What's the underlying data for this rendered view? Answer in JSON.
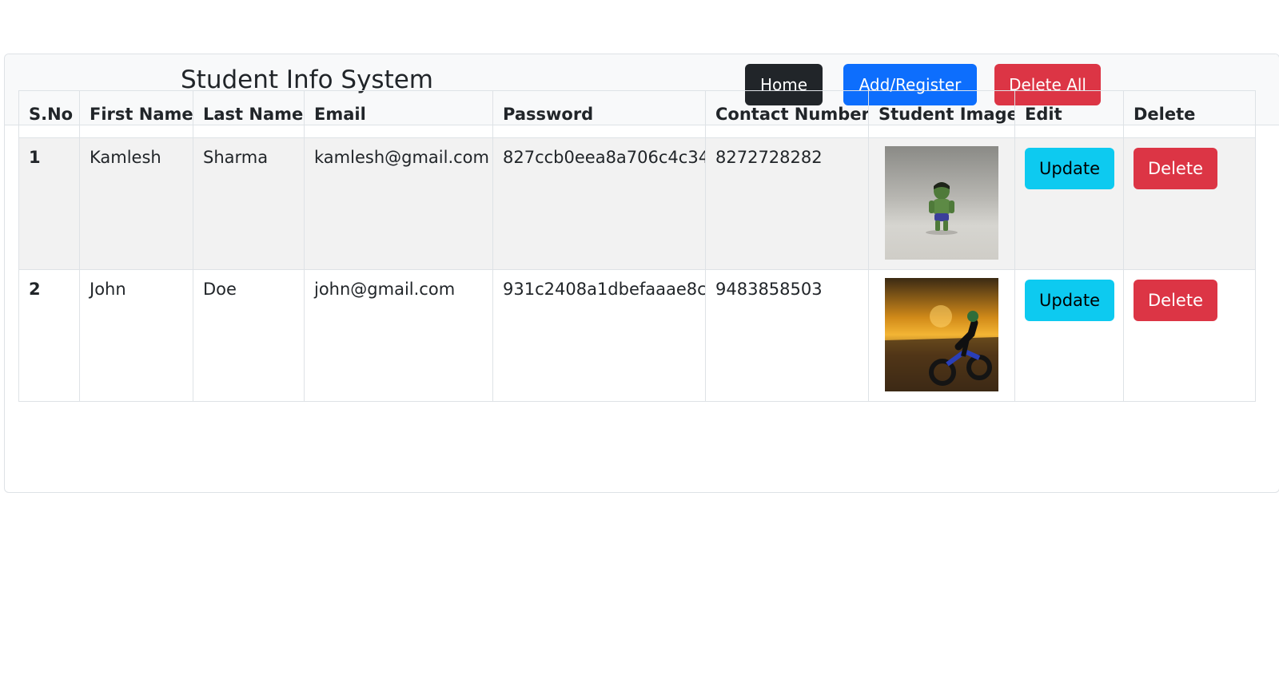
{
  "header": {
    "title": "Student Info System",
    "buttons": {
      "home": "Home",
      "add_register": "Add/Register",
      "delete_all": "Delete All"
    }
  },
  "table": {
    "columns": [
      "S.No",
      "First Name",
      "Last Name",
      "Email",
      "Password",
      "Contact Number",
      "Student Image",
      "Edit",
      "Delete"
    ],
    "rows": [
      {
        "sno": "1",
        "first_name": "Kamlesh",
        "last_name": "Sharma",
        "email": "kamlesh@gmail.com",
        "password": "827ccb0eea8a706c4c34",
        "contact": "8272728282",
        "image": "student-photo-hulk-figure",
        "edit_label": "Update",
        "delete_label": "Delete"
      },
      {
        "sno": "2",
        "first_name": "John",
        "last_name": "Doe",
        "email": "john@gmail.com",
        "password": "931c2408a1dbefaaae8c",
        "contact": "9483858503",
        "image": "student-photo-motorbike-sunset",
        "edit_label": "Update",
        "delete_label": "Delete"
      }
    ]
  },
  "colors": {
    "dark": "#212529",
    "primary": "#0d6efd",
    "danger": "#dc3545",
    "info": "#0dcaf0",
    "stripe": "#f2f2f2",
    "header_bg": "#f8f9fa"
  }
}
